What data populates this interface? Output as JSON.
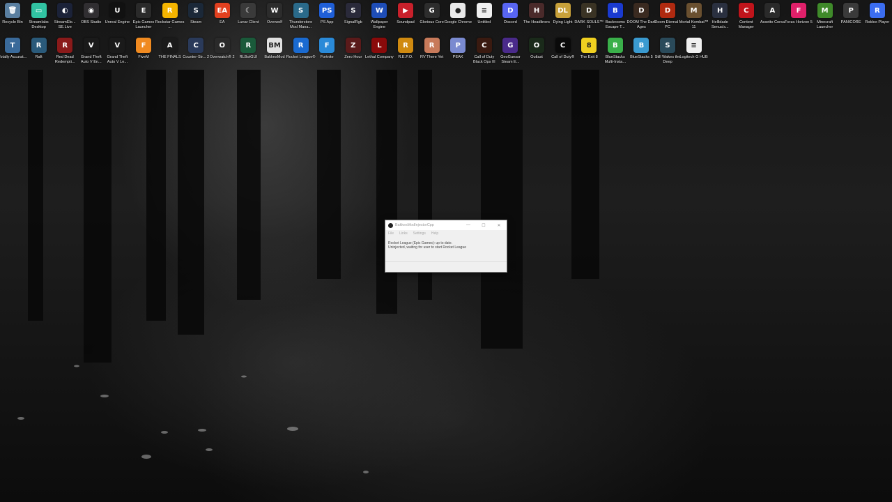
{
  "desktop": {
    "row1": [
      {
        "label": "Recycle Bin",
        "icon": "recycle-bin-icon",
        "color": "#5a7fa0",
        "glyph": "🗑"
      },
      {
        "label": "Streamlabs Desktop",
        "icon": "streamlabs-icon",
        "color": "#31c3a2",
        "glyph": "▭"
      },
      {
        "label": "StreamEle... SE.Live",
        "icon": "streamelements-icon",
        "color": "#1b2238",
        "glyph": "◐"
      },
      {
        "label": "OBS Studio",
        "icon": "obs-icon",
        "color": "#302e31",
        "glyph": "◉"
      },
      {
        "label": "Unreal Engine",
        "icon": "unreal-engine-icon",
        "color": "#111111",
        "glyph": "U"
      },
      {
        "label": "Epic Games Launcher",
        "icon": "epic-games-icon",
        "color": "#2a2a2a",
        "glyph": "E"
      },
      {
        "label": "Rockstar Games ...",
        "icon": "rockstar-icon",
        "color": "#f4b400",
        "glyph": "R"
      },
      {
        "label": "Steam",
        "icon": "steam-icon",
        "color": "#1b2838",
        "glyph": "S"
      },
      {
        "label": "EA",
        "icon": "ea-icon",
        "color": "#e2401f",
        "glyph": "EA"
      },
      {
        "label": "Lunar Client",
        "icon": "lunar-client-icon",
        "color": "#3a3a3a",
        "glyph": "☾"
      },
      {
        "label": "Overwolf",
        "icon": "overwolf-icon",
        "color": "#2c2c2c",
        "glyph": "W"
      },
      {
        "label": "Thunderstore Mod Mana...",
        "icon": "thunderstore-icon",
        "color": "#2a6a8a",
        "glyph": "S"
      },
      {
        "label": "PS App",
        "icon": "ps-app-icon",
        "color": "#1f5fd8",
        "glyph": "PS"
      },
      {
        "label": "SignalRgb",
        "icon": "signalrgb-icon",
        "color": "#2a2a3a",
        "glyph": "S"
      },
      {
        "label": "Wallpaper Engine",
        "icon": "wallpaper-engine-icon",
        "color": "#1e4db7",
        "glyph": "W"
      },
      {
        "label": "Soundpad",
        "icon": "soundpad-icon",
        "color": "#c8202b",
        "glyph": "▶"
      },
      {
        "label": "Glorious Core",
        "icon": "glorious-icon",
        "color": "#2d2d2d",
        "glyph": "G"
      },
      {
        "label": "Google Chrome",
        "icon": "chrome-icon",
        "color": "#e9e9e9",
        "glyph": "●"
      },
      {
        "label": "Untitled",
        "icon": "document-icon",
        "color": "#f0f0f0",
        "glyph": "≡"
      },
      {
        "label": "Discord",
        "icon": "discord-icon",
        "color": "#5865f2",
        "glyph": "D"
      },
      {
        "label": "The Headliners",
        "icon": "headliners-icon",
        "color": "#4a2a2a",
        "glyph": "H"
      },
      {
        "label": "Dying Light",
        "icon": "dying-light-icon",
        "color": "#c8a13a",
        "glyph": "DL"
      },
      {
        "label": "DARK SOULS™ III",
        "icon": "dark-souls-icon",
        "color": "#3a3324",
        "glyph": "D"
      },
      {
        "label": "Backrooms Escape T...",
        "icon": "backrooms-icon",
        "color": "#1a3ad0",
        "glyph": "B"
      },
      {
        "label": "DOOM The Dark Ages",
        "icon": "doom-dark-ages-icon",
        "color": "#3a2a20",
        "glyph": "D"
      },
      {
        "label": "Doom Eternal - PC",
        "icon": "doom-eternal-icon",
        "color": "#b02a10",
        "glyph": "D"
      },
      {
        "label": "Mortal Kombat™ 11",
        "icon": "mortal-kombat-icon",
        "color": "#6a5030",
        "glyph": "M"
      },
      {
        "label": "Hellblade Senua's...",
        "icon": "hellblade-icon",
        "color": "#2a3040",
        "glyph": "H"
      },
      {
        "label": "Content Manager",
        "icon": "content-manager-icon",
        "color": "#c0141b",
        "glyph": "C"
      },
      {
        "label": "Assetto Corsa",
        "icon": "assetto-corsa-icon",
        "color": "#2a2a2a",
        "glyph": "A"
      },
      {
        "label": "Forza Horizon 5",
        "icon": "forza-icon",
        "color": "#e0206a",
        "glyph": "F"
      },
      {
        "label": "Minecraft Launcher",
        "icon": "minecraft-icon",
        "color": "#3f8a2a",
        "glyph": "M"
      },
      {
        "label": "PANICORE",
        "icon": "panicore-icon",
        "color": "#3a3a3a",
        "glyph": "P"
      },
      {
        "label": "Roblox Player",
        "icon": "roblox-icon",
        "color": "#3b6df0",
        "glyph": "R"
      }
    ],
    "row2": [
      {
        "label": "Totally Accurat...",
        "icon": "tabs-icon",
        "color": "#3a6a9a",
        "glyph": "T"
      },
      {
        "label": "Raft",
        "icon": "raft-icon",
        "color": "#2a5a7a",
        "glyph": "R"
      },
      {
        "label": "Red Dead Redempti...",
        "icon": "rdr-icon",
        "color": "#8a1a1a",
        "glyph": "R"
      },
      {
        "label": "Grand Theft Auto V En...",
        "icon": "gta-v-enhanced-icon",
        "color": "#1a1a1a",
        "glyph": "V"
      },
      {
        "label": "Grand Theft Auto V Le...",
        "icon": "gta-v-legacy-icon",
        "color": "#1a1a1a",
        "glyph": "V"
      },
      {
        "label": "FiveM",
        "icon": "fivem-icon",
        "color": "#f08a20",
        "glyph": "F"
      },
      {
        "label": "THE FINALS",
        "icon": "the-finals-icon",
        "color": "#1a1a1a",
        "glyph": "A"
      },
      {
        "label": "Counter-Str... 2",
        "icon": "cs2-icon",
        "color": "#2a3a5a",
        "glyph": "C"
      },
      {
        "label": "Overwatch® 2",
        "icon": "overwatch-icon",
        "color": "#2a2a2a",
        "glyph": "O"
      },
      {
        "label": "RLBotGUI",
        "icon": "rlbot-icon",
        "color": "#1a5a3a",
        "glyph": "R"
      },
      {
        "label": "BakkesMod",
        "icon": "bakkesmod-icon",
        "color": "#e0e0e0",
        "glyph": "BM"
      },
      {
        "label": "Rocket League®",
        "icon": "rocket-league-icon",
        "color": "#1a6ad0",
        "glyph": "R"
      },
      {
        "label": "Fortnite",
        "icon": "fortnite-icon",
        "color": "#2a8ad8",
        "glyph": "F"
      },
      {
        "label": "Zero Hour",
        "icon": "zero-hour-icon",
        "color": "#5a1a1a",
        "glyph": "Z"
      },
      {
        "label": "Lethal Company",
        "icon": "lethal-company-icon",
        "color": "#8a0a0a",
        "glyph": "L"
      },
      {
        "label": "R.E.P.O.",
        "icon": "repo-icon",
        "color": "#d08a10",
        "glyph": "R"
      },
      {
        "label": "RV There Yet",
        "icon": "rv-there-yet-icon",
        "color": "#c87a5a",
        "glyph": "R"
      },
      {
        "label": "PEAK",
        "icon": "peak-icon",
        "color": "#7a8ad0",
        "glyph": "P"
      },
      {
        "label": "Call of Duty Black Ops III",
        "icon": "cod-bo3-icon",
        "color": "#3a1a10",
        "glyph": "C"
      },
      {
        "label": "GeoGuessr Steam E...",
        "icon": "geoguessr-icon",
        "color": "#4a2a8a",
        "glyph": "G"
      },
      {
        "label": "Outlast",
        "icon": "outlast-icon",
        "color": "#1a2a1a",
        "glyph": "O"
      },
      {
        "label": "Call of Duty®",
        "icon": "call-of-duty-icon",
        "color": "#0a0a0a",
        "glyph": "C"
      },
      {
        "label": "The Exit 8",
        "icon": "exit-8-icon",
        "color": "#f0d020",
        "glyph": "8"
      },
      {
        "label": "BlueStacks Multi-Insta...",
        "icon": "bluestacks-multi-icon",
        "color": "#3ab04a",
        "glyph": "B"
      },
      {
        "label": "BlueStacks 5",
        "icon": "bluestacks-icon",
        "color": "#3a9ad0",
        "glyph": "B"
      },
      {
        "label": "Still Wakes the Deep",
        "icon": "still-wakes-icon",
        "color": "#2a4a5a",
        "glyph": "S"
      },
      {
        "label": "Logitech G HUB",
        "icon": "logitech-icon",
        "color": "#f0f0f0",
        "glyph": "≡"
      }
    ]
  },
  "dialog": {
    "title": "BakkesModInjectorCpp",
    "minimize": "—",
    "maximize": "☐",
    "close": "✕",
    "menu": [
      "File",
      "Links",
      "Settings",
      "Help"
    ],
    "status_line1": "Rocket League (Epic Games): up to date.",
    "status_line2": "Uninjected, waiting for user to start Rocket League"
  }
}
